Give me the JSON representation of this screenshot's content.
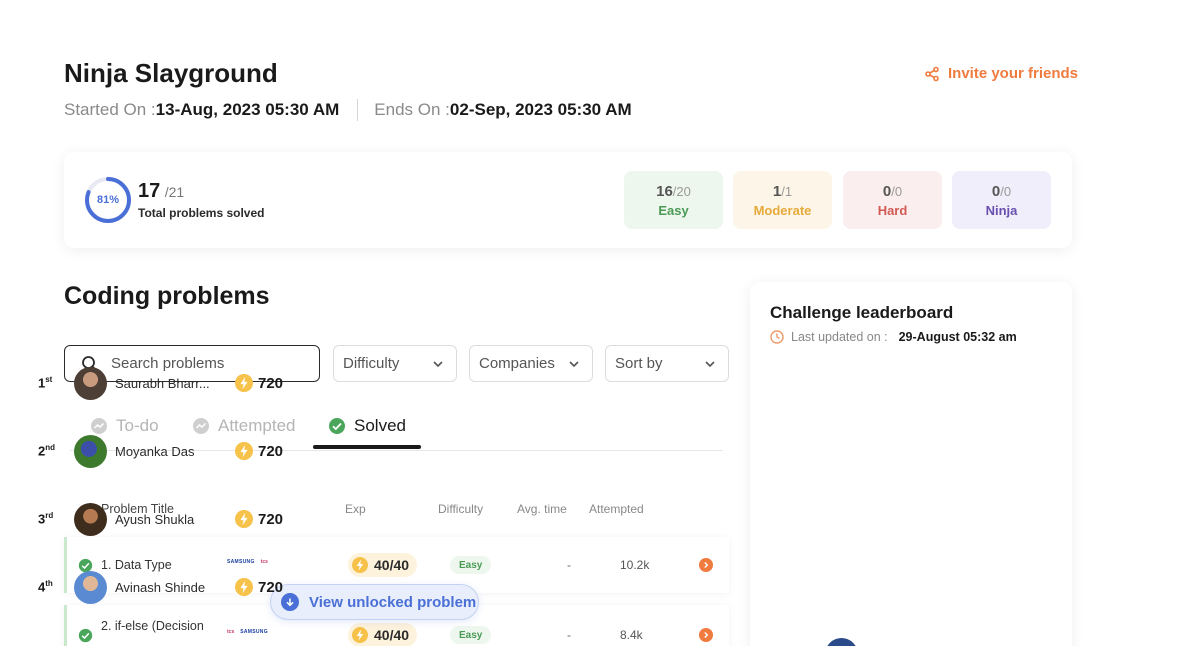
{
  "header": {
    "title": "Ninja Slayground",
    "invite_label": "Invite your friends",
    "started_label": "Started On :",
    "started_value": "13-Aug, 2023 05:30 AM",
    "ends_label": "Ends On :",
    "ends_value": "02-Sep, 2023 05:30 AM"
  },
  "summary": {
    "percent_label": "81%",
    "percent_value": 0.81,
    "solved": "17",
    "total": "/21",
    "solved_label": "Total problems solved",
    "difficulties": [
      {
        "solved": "16",
        "total": "/20",
        "name": "Easy"
      },
      {
        "solved": "1",
        "total": "/1",
        "name": "Moderate"
      },
      {
        "solved": "0",
        "total": "/0",
        "name": "Hard"
      },
      {
        "solved": "0",
        "total": "/0",
        "name": "Ninja"
      }
    ]
  },
  "problems": {
    "section_title": "Coding problems",
    "search_placeholder": "Search problems",
    "filters": {
      "difficulty": "Difficulty",
      "companies": "Companies",
      "sort": "Sort by"
    },
    "tabs": [
      {
        "label": "To-do"
      },
      {
        "label": "Attempted"
      },
      {
        "label": "Solved"
      }
    ],
    "columns": {
      "title": "Problem Title",
      "exp": "Exp",
      "difficulty": "Difficulty",
      "avg_time": "Avg. time",
      "attempted": "Attempted"
    },
    "rows": [
      {
        "title": "1. Data Type",
        "logos": [
          "SAMSUNG",
          "tcs"
        ],
        "exp": "40/40",
        "difficulty": "Easy",
        "avg_time": "-",
        "attempted": "10.2k"
      },
      {
        "title": "2. if-else (Decision",
        "logos": [
          "tcs",
          "SAMSUNG"
        ],
        "exp": "40/40",
        "difficulty": "Easy",
        "avg_time": "-",
        "attempted": "8.4k"
      }
    ],
    "unlock_label": "View unlocked problem"
  },
  "leaderboard": {
    "title": "Challenge leaderboard",
    "updated_label": "Last updated on :",
    "updated_value": "29-August 05:32 am",
    "entries": [
      {
        "rank": "1",
        "suffix": "st",
        "name": "Saurabh Bharr...",
        "score": "720"
      },
      {
        "rank": "2",
        "suffix": "nd",
        "name": "Moyanka Das",
        "score": "720"
      },
      {
        "rank": "3",
        "suffix": "rd",
        "name": "Ayush Shukla",
        "score": "720"
      },
      {
        "rank": "4",
        "suffix": "th",
        "name": "Avinash Shinde",
        "score": "720"
      }
    ]
  },
  "colors": {
    "accent_orange": "#ef7b3e",
    "accent_blue": "#4a6fd6",
    "easy_green": "#4a9a55",
    "moderate_yellow": "#e6a93a",
    "hard_red": "#d25a55",
    "ninja_purple": "#6a4fb0"
  },
  "icons": {
    "invite": "share-icon",
    "search": "search-icon",
    "dropdown": "chevron-down-icon",
    "solved_check": "check-circle-icon",
    "tab_status": "trend-circle-icon",
    "exp": "lightning-bolt-icon",
    "open_problem": "chevron-right-circle-icon",
    "unlock": "arrow-down-circle-icon",
    "updated": "clock-icon"
  }
}
